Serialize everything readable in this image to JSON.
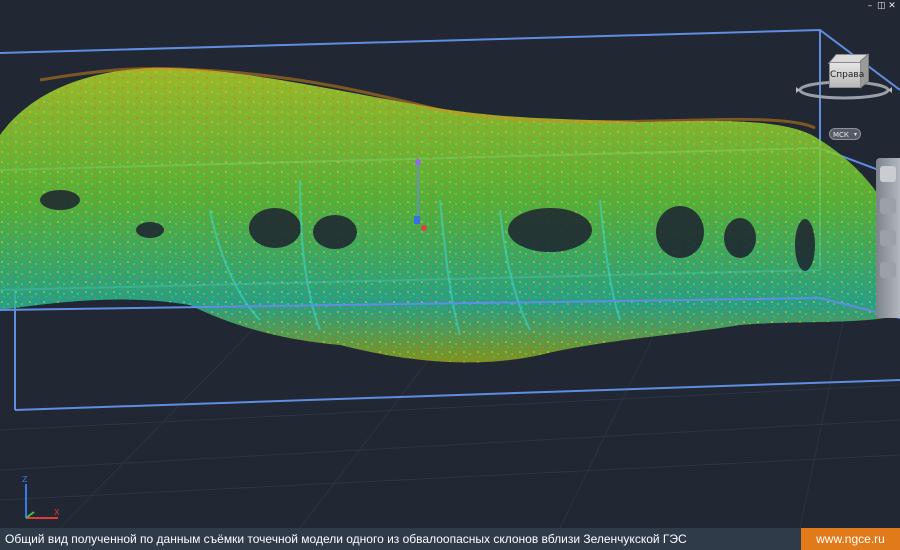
{
  "window": {
    "controls": [
      "minimize-icon",
      "restore-icon",
      "close-icon"
    ]
  },
  "viewcube": {
    "face_label": "Справа"
  },
  "wcs": {
    "label": "МСК"
  },
  "caption": {
    "text": "Общий вид полученной по данным съёмки точечной модели одного из обвалоопасных склонов вблизи Зеленчукской ГЭС",
    "site": "www.ngce.ru"
  },
  "colors": {
    "viewport_bg": "#212733",
    "caption_bg": "#2f3b49",
    "site_bg": "#e07a1a",
    "bbox_line": "#5f8de0",
    "points": [
      "#c8b020",
      "#a6d22a",
      "#5cc83a",
      "#22b08a",
      "#d97a1a"
    ]
  }
}
